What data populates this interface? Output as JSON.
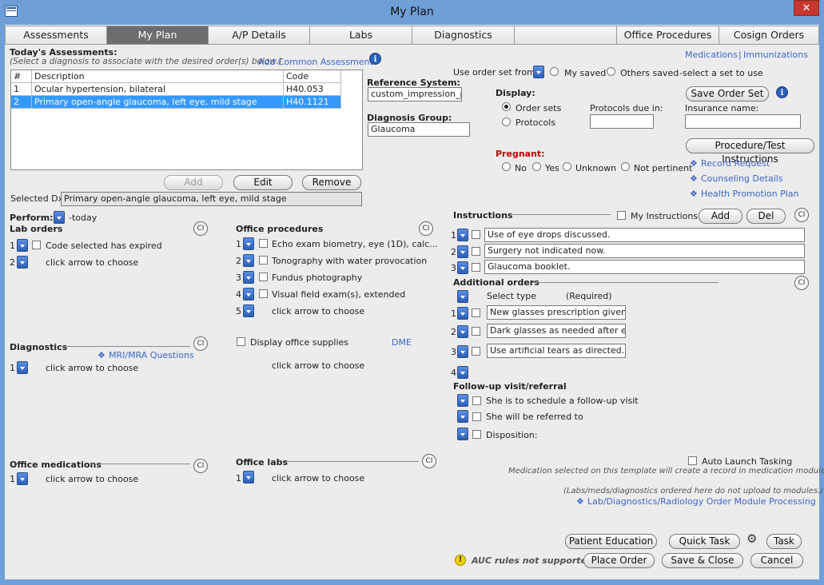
{
  "window": {
    "title": "My Plan",
    "close": "✕"
  },
  "tabs": [
    "Assessments",
    "My Plan",
    "A/P Details",
    "Labs",
    "Diagnostics",
    "",
    "Office Procedures",
    "Cosign Orders"
  ],
  "top_links": {
    "medications": "Medications",
    "sep": "|",
    "immunizations": "Immunizations"
  },
  "assessments": {
    "heading": "Today's Assessments:",
    "hint": "(Select a diagnosis to associate with the desired order(s) below.)",
    "add_common": "Add Common Assessment",
    "columns": [
      "#",
      "Description",
      "Code"
    ],
    "rows": [
      {
        "num": "1",
        "desc": "Ocular hypertension, bilateral",
        "code": "H40.053"
      },
      {
        "num": "2",
        "desc": "Primary open-angle glaucoma, left eye, mild stage",
        "code": "H40.1121"
      }
    ],
    "buttons": {
      "add": "Add",
      "edit": "Edit",
      "remove": "Remove"
    },
    "selected_label": "Selected Dx:",
    "selected_value": "Primary open-angle glaucoma, left eye, mild stage"
  },
  "reference": {
    "label": "Reference System:",
    "value": "custom_impression_pl",
    "group_label": "Diagnosis Group:",
    "group_value": "Glaucoma"
  },
  "order_set": {
    "label": "Use order set from:",
    "my_saved": "My saved",
    "others_saved": "Others saved",
    "hint": "-select a set to use",
    "save_btn": "Save Order Set"
  },
  "display": {
    "label": "Display:",
    "order_sets": "Order sets",
    "protocols": "Protocols",
    "protocols_due": "Protocols due in:",
    "insurance": "Insurance name:"
  },
  "pregnant": {
    "label": "Pregnant:",
    "options": [
      "No",
      "Yes",
      "Unknown",
      "Not pertinent"
    ]
  },
  "proc_btn": "Procedure/Test Instructions",
  "right_links": [
    "Record Request",
    "Counseling Details",
    "Health Promotion Plan"
  ],
  "perform": {
    "label": "Perform:",
    "value": "-today"
  },
  "cl": "CI",
  "lab_orders": {
    "title": "Lab orders",
    "items": [
      {
        "num": "1",
        "text": "Code selected has expired"
      },
      {
        "num": "2",
        "text": "click arrow to choose"
      }
    ]
  },
  "office_procedures": {
    "title": "Office procedures",
    "items": [
      {
        "num": "1",
        "text": "Echo exam biometry, eye (1D), calc..."
      },
      {
        "num": "2",
        "text": "Tonography with water provocation"
      },
      {
        "num": "3",
        "text": "Fundus photography"
      },
      {
        "num": "4",
        "text": "Visual field exam(s), extended"
      },
      {
        "num": "5",
        "text": "click arrow to choose"
      }
    ]
  },
  "diagnostics": {
    "title": "Diagnostics",
    "mri": "MRI/MRA Questions",
    "num": "1",
    "text": "click arrow to choose"
  },
  "supplies": {
    "label": "Display office supplies",
    "dme": "DME",
    "text": "click arrow to choose"
  },
  "office_meds": {
    "title": "Office medications",
    "num": "1",
    "text": "click arrow to choose"
  },
  "office_labs": {
    "title": "Office labs",
    "num": "1",
    "text": "click arrow to choose"
  },
  "instructions": {
    "title": "Instructions",
    "my_label": "My Instructions",
    "add": "Add",
    "del": "Del",
    "items": [
      {
        "num": "1",
        "text": "Use of eye drops discussed."
      },
      {
        "num": "2",
        "text": "Surgery not indicated now."
      },
      {
        "num": "3",
        "text": "Glaucoma booklet."
      }
    ]
  },
  "additional": {
    "title": "Additional orders",
    "select_type": "Select type",
    "required": "(Required)",
    "items": [
      {
        "num": "1",
        "text": "New glasses prescription given."
      },
      {
        "num": "2",
        "text": "Dark glasses as needed after eye"
      },
      {
        "num": "3",
        "text": "Use artificial tears as directed."
      }
    ],
    "extra_num": "4"
  },
  "followup": {
    "title": "Follow-up visit/referral",
    "items": [
      "She is to schedule a follow-up visit",
      "She will be referred to",
      "Disposition:"
    ]
  },
  "footer": {
    "auto_launch": "Auto Launch Tasking",
    "med_note": "Medication selected on this template will create a record in medication module.",
    "labs_note": "(Labs/meds/diagnostics ordered here do not upload to modules.)",
    "lab_link": "Lab/Diagnostics/Radiology Order Module Processing",
    "patient_ed": "Patient Education",
    "quick_task": "Quick Task",
    "task": "Task",
    "auc": "AUC rules not supported.",
    "place_order": "Place Order",
    "save_close": "Save & Close",
    "cancel": "Cancel"
  },
  "icons": {
    "info": "i",
    "warn": "!",
    "gear": "⚙",
    "diamond": "❖"
  }
}
